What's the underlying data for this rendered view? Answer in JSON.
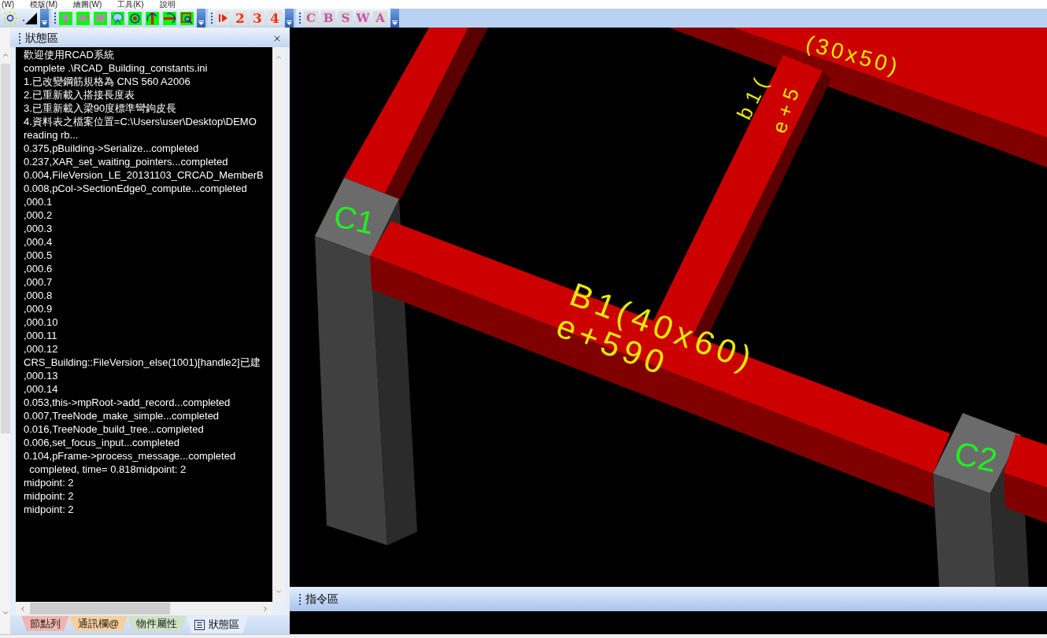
{
  "menu_bar": [
    "(W)",
    "模版(M)",
    "繪圖(W)",
    "工具(K)",
    "說明"
  ],
  "step_toolbar": {
    "buttons": [
      "2",
      "3",
      "4"
    ]
  },
  "letter_toolbar": {
    "buttons": [
      "C",
      "B",
      "S",
      "W",
      "A"
    ]
  },
  "status_panel": {
    "title": "狀態區",
    "log_lines": [
      "歡迎使用RCAD系統",
      "complete .\\RCAD_Building_constants.ini",
      "1.已改變鋼筋規格為 CNS 560 A2006",
      "2.已重新載入搭接長度表",
      "3.已重新載入梁90度標準彎鉤皮長",
      "4.資料表之檔案位置=C:\\Users\\user\\Desktop\\DEMO",
      "reading rb...",
      "0.375,pBuilding->Serialize...completed",
      "0.237,XAR_set_waiting_pointers...completed",
      "0.004,FileVersion_LE_20131103_CRCAD_MemberB",
      "0.008,pCol->SectionEdge0_compute...completed",
      ",000.1",
      ",000.2",
      ",000.3",
      ",000.4",
      ",000.5",
      ",000.6",
      ",000.7",
      ",000.8",
      ",000.9",
      ",000.10",
      ",000.11",
      ",000.12",
      "CRS_Building::FileVersion_else(1001)[handle2]已建",
      ",000.13",
      ",000.14",
      "0.053,this->mpRoot->add_record...completed",
      "0.007,TreeNode_make_simple...completed",
      "0.016,TreeNode_build_tree...completed",
      "0.006,set_focus_input...completed",
      "0.104,pFrame->process_message...completed",
      "  completed, time= 0.818midpoint: 2",
      "midpoint: 2",
      "midpoint: 2",
      "midpoint: 2"
    ]
  },
  "bottom_tabs": [
    {
      "label": "節點列",
      "color": "#f2b5ae",
      "selected": false
    },
    {
      "label": "通訊欄@",
      "color": "#f8cf9c",
      "selected": false
    },
    {
      "label": "物件屬性",
      "color": "#cfe3c5",
      "selected": false
    },
    {
      "label": "狀態區",
      "color": "#e4edfa",
      "selected": true
    }
  ],
  "viewport": {
    "column_labels": [
      "C1",
      "C2"
    ],
    "beam_labels": [
      "B1(40x60)",
      "e+590",
      "(30x50)",
      "b1(",
      "e+5"
    ]
  },
  "command_panel": {
    "title": "指令區"
  }
}
